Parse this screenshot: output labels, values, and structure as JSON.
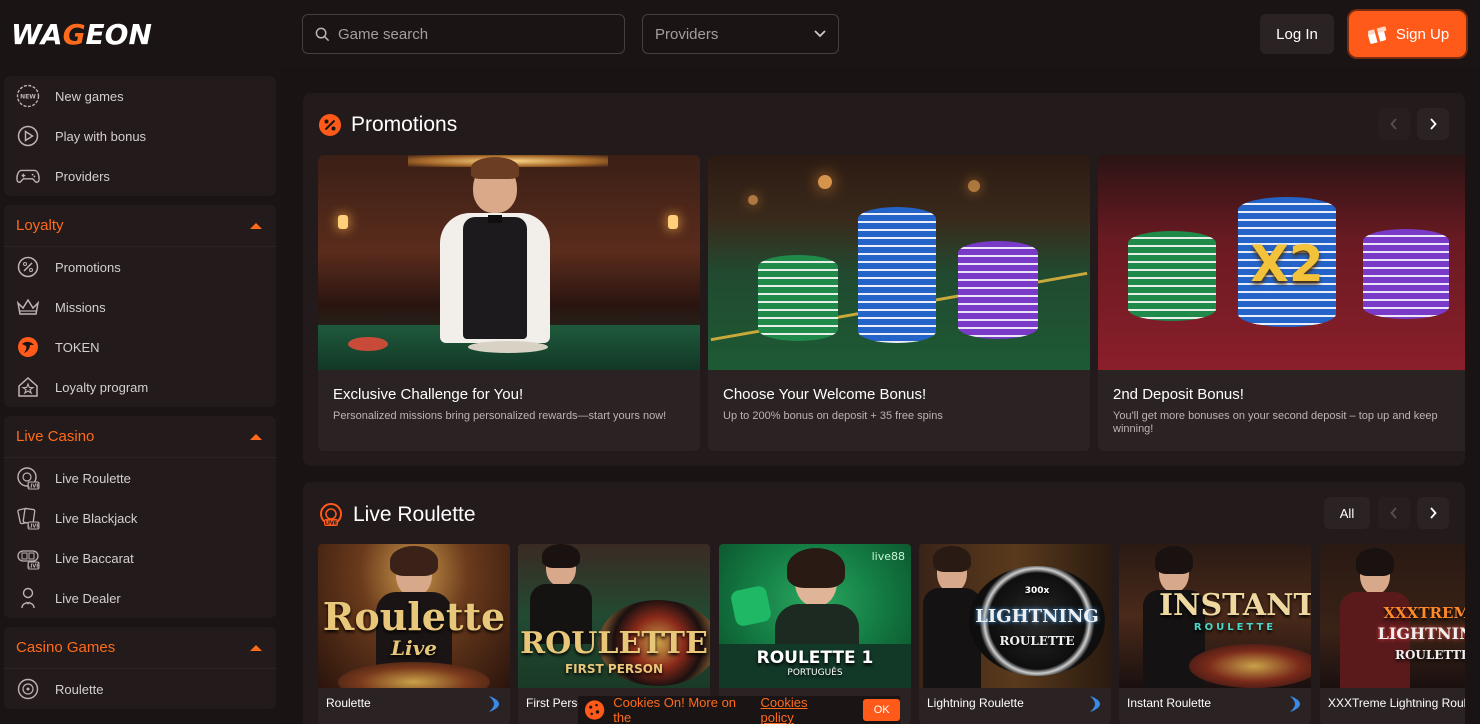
{
  "header": {
    "logo_text_1": "WA",
    "logo_text_accent": "G",
    "logo_text_2": "EON",
    "search_placeholder": "Game search",
    "providers_label": "Providers",
    "login_label": "Log In",
    "signup_label": "Sign Up"
  },
  "sidebar": {
    "top_items": [
      {
        "label": "New games",
        "icon": "new-icon"
      },
      {
        "label": "Play with bonus",
        "icon": "play-icon"
      },
      {
        "label": "Providers",
        "icon": "gamepad-icon"
      }
    ],
    "loyalty": {
      "title": "Loyalty",
      "items": [
        {
          "label": "Promotions",
          "icon": "percent-icon"
        },
        {
          "label": "Missions",
          "icon": "crown-icon"
        },
        {
          "label": "TOKEN",
          "icon": "token-icon"
        },
        {
          "label": "Loyalty program",
          "icon": "house-star-icon"
        }
      ]
    },
    "live_casino": {
      "title": "Live Casino",
      "items": [
        {
          "label": "Live Roulette",
          "icon": "live-roulette-icon"
        },
        {
          "label": "Live Blackjack",
          "icon": "live-cards-icon"
        },
        {
          "label": "Live Baccarat",
          "icon": "live-baccarat-icon"
        },
        {
          "label": "Live Dealer",
          "icon": "dealer-icon"
        }
      ]
    },
    "casino_games": {
      "title": "Casino Games",
      "items": [
        {
          "label": "Roulette",
          "icon": "roulette-icon"
        }
      ]
    }
  },
  "promotions": {
    "title": "Promotions",
    "cards": [
      {
        "title": "Exclusive Challenge for You!",
        "desc": "Personalized missions bring personalized rewards—start yours now!"
      },
      {
        "title": "Choose Your Welcome Bonus!",
        "desc": "Up to 200% bonus on deposit + 35 free spins"
      },
      {
        "title": "2nd Deposit Bonus!",
        "desc": "You'll get more bonuses on your second deposit – top up and keep winning!",
        "badge": "X2"
      }
    ]
  },
  "live_roulette": {
    "title": "Live Roulette",
    "all_label": "All",
    "games": [
      {
        "name": "Roulette",
        "art_1": "Roulette",
        "art_2": "Live"
      },
      {
        "name": "First Person Roulette",
        "art_1": "ROULETTE",
        "art_2": "FIRST PERSON"
      },
      {
        "name": "Roulette 1 Português",
        "art_1": "ROULETTE 1",
        "art_2": "PORTUGUÊS",
        "provider": "live88"
      },
      {
        "name": "Lightning Roulette",
        "art_1": "LIGHTNING",
        "art_2": "ROULETTE",
        "art_3": "300x"
      },
      {
        "name": "Instant Roulette",
        "art_1": "INSTANT",
        "art_2": "ROULETTE"
      },
      {
        "name": "XXXTreme Lightning Roulette",
        "art_1": "XXXTREME",
        "art_2": "LIGHTNING",
        "art_3": "ROULETTE"
      }
    ]
  },
  "cookie": {
    "text": "Cookies On! More on the",
    "link": "Cookies policy",
    "ok": "OK"
  },
  "colors": {
    "accent": "#ff5a1a",
    "background": "#1a1314",
    "panel": "#221a1b"
  }
}
